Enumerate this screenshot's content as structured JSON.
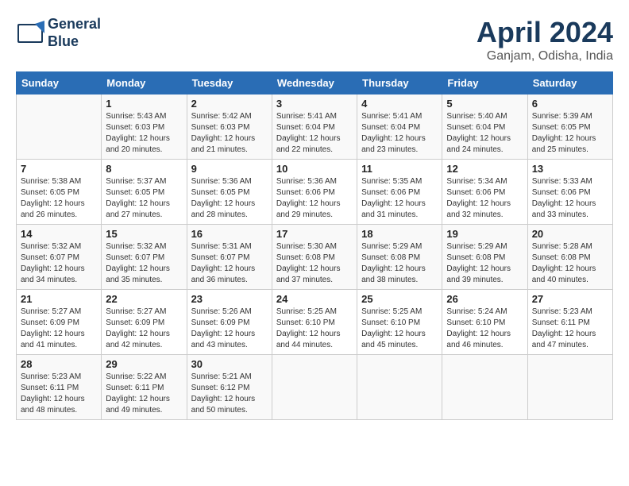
{
  "header": {
    "logo_line1": "General",
    "logo_line2": "Blue",
    "month": "April 2024",
    "location": "Ganjam, Odisha, India"
  },
  "weekdays": [
    "Sunday",
    "Monday",
    "Tuesday",
    "Wednesday",
    "Thursday",
    "Friday",
    "Saturday"
  ],
  "weeks": [
    [
      {
        "num": "",
        "info": ""
      },
      {
        "num": "1",
        "info": "Sunrise: 5:43 AM\nSunset: 6:03 PM\nDaylight: 12 hours\nand 20 minutes."
      },
      {
        "num": "2",
        "info": "Sunrise: 5:42 AM\nSunset: 6:03 PM\nDaylight: 12 hours\nand 21 minutes."
      },
      {
        "num": "3",
        "info": "Sunrise: 5:41 AM\nSunset: 6:04 PM\nDaylight: 12 hours\nand 22 minutes."
      },
      {
        "num": "4",
        "info": "Sunrise: 5:41 AM\nSunset: 6:04 PM\nDaylight: 12 hours\nand 23 minutes."
      },
      {
        "num": "5",
        "info": "Sunrise: 5:40 AM\nSunset: 6:04 PM\nDaylight: 12 hours\nand 24 minutes."
      },
      {
        "num": "6",
        "info": "Sunrise: 5:39 AM\nSunset: 6:05 PM\nDaylight: 12 hours\nand 25 minutes."
      }
    ],
    [
      {
        "num": "7",
        "info": "Sunrise: 5:38 AM\nSunset: 6:05 PM\nDaylight: 12 hours\nand 26 minutes."
      },
      {
        "num": "8",
        "info": "Sunrise: 5:37 AM\nSunset: 6:05 PM\nDaylight: 12 hours\nand 27 minutes."
      },
      {
        "num": "9",
        "info": "Sunrise: 5:36 AM\nSunset: 6:05 PM\nDaylight: 12 hours\nand 28 minutes."
      },
      {
        "num": "10",
        "info": "Sunrise: 5:36 AM\nSunset: 6:06 PM\nDaylight: 12 hours\nand 29 minutes."
      },
      {
        "num": "11",
        "info": "Sunrise: 5:35 AM\nSunset: 6:06 PM\nDaylight: 12 hours\nand 31 minutes."
      },
      {
        "num": "12",
        "info": "Sunrise: 5:34 AM\nSunset: 6:06 PM\nDaylight: 12 hours\nand 32 minutes."
      },
      {
        "num": "13",
        "info": "Sunrise: 5:33 AM\nSunset: 6:06 PM\nDaylight: 12 hours\nand 33 minutes."
      }
    ],
    [
      {
        "num": "14",
        "info": "Sunrise: 5:32 AM\nSunset: 6:07 PM\nDaylight: 12 hours\nand 34 minutes."
      },
      {
        "num": "15",
        "info": "Sunrise: 5:32 AM\nSunset: 6:07 PM\nDaylight: 12 hours\nand 35 minutes."
      },
      {
        "num": "16",
        "info": "Sunrise: 5:31 AM\nSunset: 6:07 PM\nDaylight: 12 hours\nand 36 minutes."
      },
      {
        "num": "17",
        "info": "Sunrise: 5:30 AM\nSunset: 6:08 PM\nDaylight: 12 hours\nand 37 minutes."
      },
      {
        "num": "18",
        "info": "Sunrise: 5:29 AM\nSunset: 6:08 PM\nDaylight: 12 hours\nand 38 minutes."
      },
      {
        "num": "19",
        "info": "Sunrise: 5:29 AM\nSunset: 6:08 PM\nDaylight: 12 hours\nand 39 minutes."
      },
      {
        "num": "20",
        "info": "Sunrise: 5:28 AM\nSunset: 6:08 PM\nDaylight: 12 hours\nand 40 minutes."
      }
    ],
    [
      {
        "num": "21",
        "info": "Sunrise: 5:27 AM\nSunset: 6:09 PM\nDaylight: 12 hours\nand 41 minutes."
      },
      {
        "num": "22",
        "info": "Sunrise: 5:27 AM\nSunset: 6:09 PM\nDaylight: 12 hours\nand 42 minutes."
      },
      {
        "num": "23",
        "info": "Sunrise: 5:26 AM\nSunset: 6:09 PM\nDaylight: 12 hours\nand 43 minutes."
      },
      {
        "num": "24",
        "info": "Sunrise: 5:25 AM\nSunset: 6:10 PM\nDaylight: 12 hours\nand 44 minutes."
      },
      {
        "num": "25",
        "info": "Sunrise: 5:25 AM\nSunset: 6:10 PM\nDaylight: 12 hours\nand 45 minutes."
      },
      {
        "num": "26",
        "info": "Sunrise: 5:24 AM\nSunset: 6:10 PM\nDaylight: 12 hours\nand 46 minutes."
      },
      {
        "num": "27",
        "info": "Sunrise: 5:23 AM\nSunset: 6:11 PM\nDaylight: 12 hours\nand 47 minutes."
      }
    ],
    [
      {
        "num": "28",
        "info": "Sunrise: 5:23 AM\nSunset: 6:11 PM\nDaylight: 12 hours\nand 48 minutes."
      },
      {
        "num": "29",
        "info": "Sunrise: 5:22 AM\nSunset: 6:11 PM\nDaylight: 12 hours\nand 49 minutes."
      },
      {
        "num": "30",
        "info": "Sunrise: 5:21 AM\nSunset: 6:12 PM\nDaylight: 12 hours\nand 50 minutes."
      },
      {
        "num": "",
        "info": ""
      },
      {
        "num": "",
        "info": ""
      },
      {
        "num": "",
        "info": ""
      },
      {
        "num": "",
        "info": ""
      }
    ]
  ]
}
